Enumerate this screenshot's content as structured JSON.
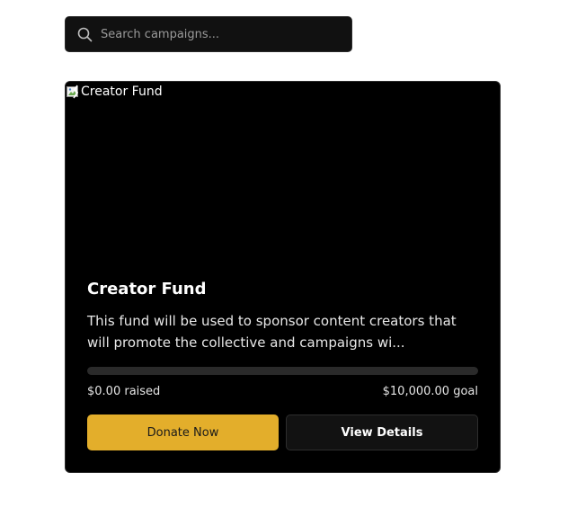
{
  "search": {
    "placeholder": "Search campaigns...",
    "value": "",
    "icon": "search-icon"
  },
  "campaign": {
    "image_alt": "Creator Fund",
    "title": "Creator Fund",
    "description": "This fund will be used to sponsor content creators that will promote the collective and campaigns wi...",
    "raised_text": "$0.00 raised",
    "goal_text": "$10,000.00 goal",
    "progress_fraction": 0,
    "donate_label": "Donate Now",
    "details_label": "View Details"
  },
  "colors": {
    "accent": "#e3ae2b",
    "card_background": "#000000",
    "track": "#2a2a2a"
  }
}
